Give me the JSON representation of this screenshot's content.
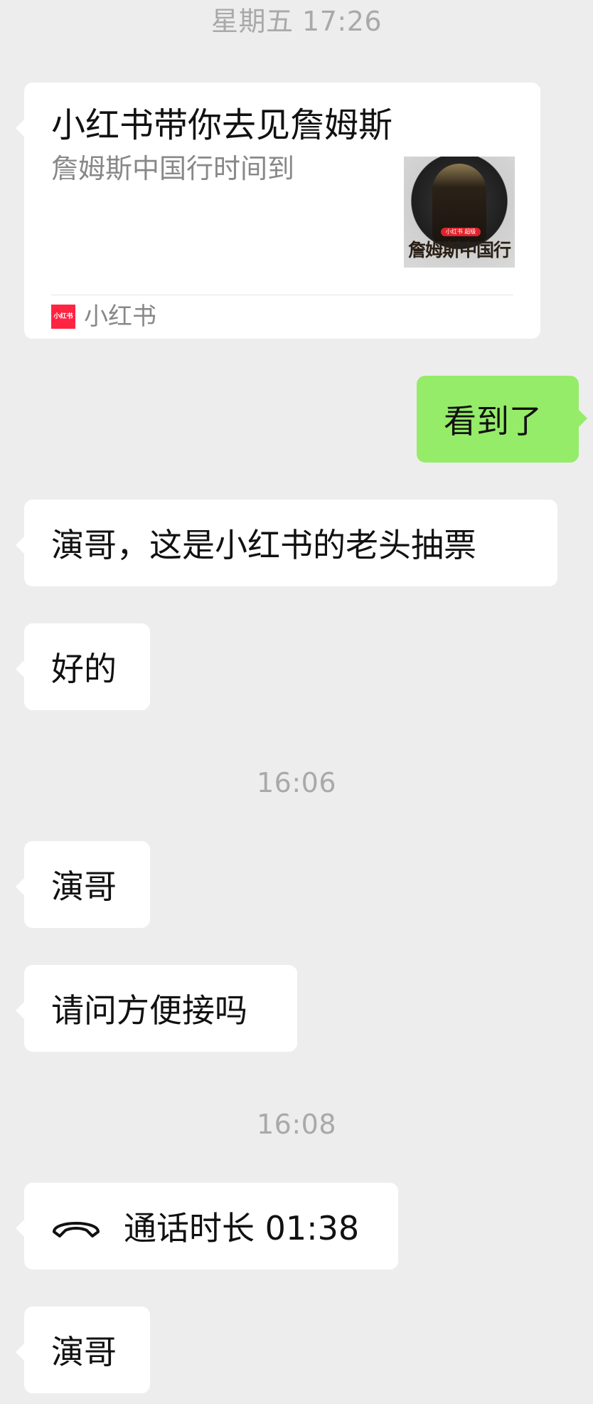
{
  "timestamps": {
    "t1": "星期五 17:26",
    "t2": "16:06",
    "t3": "16:08"
  },
  "link_card": {
    "title": "小红书带你去见詹姆斯",
    "description": "詹姆斯中国行时间到",
    "thumbnail_badge": "小红书 超级",
    "thumbnail_caption": "詹姆斯中国行",
    "source_logo_text": "小红书",
    "source_name": "小红书"
  },
  "messages": {
    "m_out_1": "看到了",
    "m_in_1": "演哥，这是小红书的老头抽票",
    "m_in_2": "好的",
    "m_in_3": "演哥",
    "m_in_4": "请问方便接吗",
    "m_in_5": "演哥"
  },
  "call": {
    "label": "通话时长 01:38",
    "icon": "phone-hangup-icon"
  },
  "colors": {
    "background": "#ededed",
    "incoming_bubble": "#ffffff",
    "outgoing_bubble": "#95ec69",
    "timestamp": "#a9a9a9",
    "brand_red": "#ff2442"
  }
}
